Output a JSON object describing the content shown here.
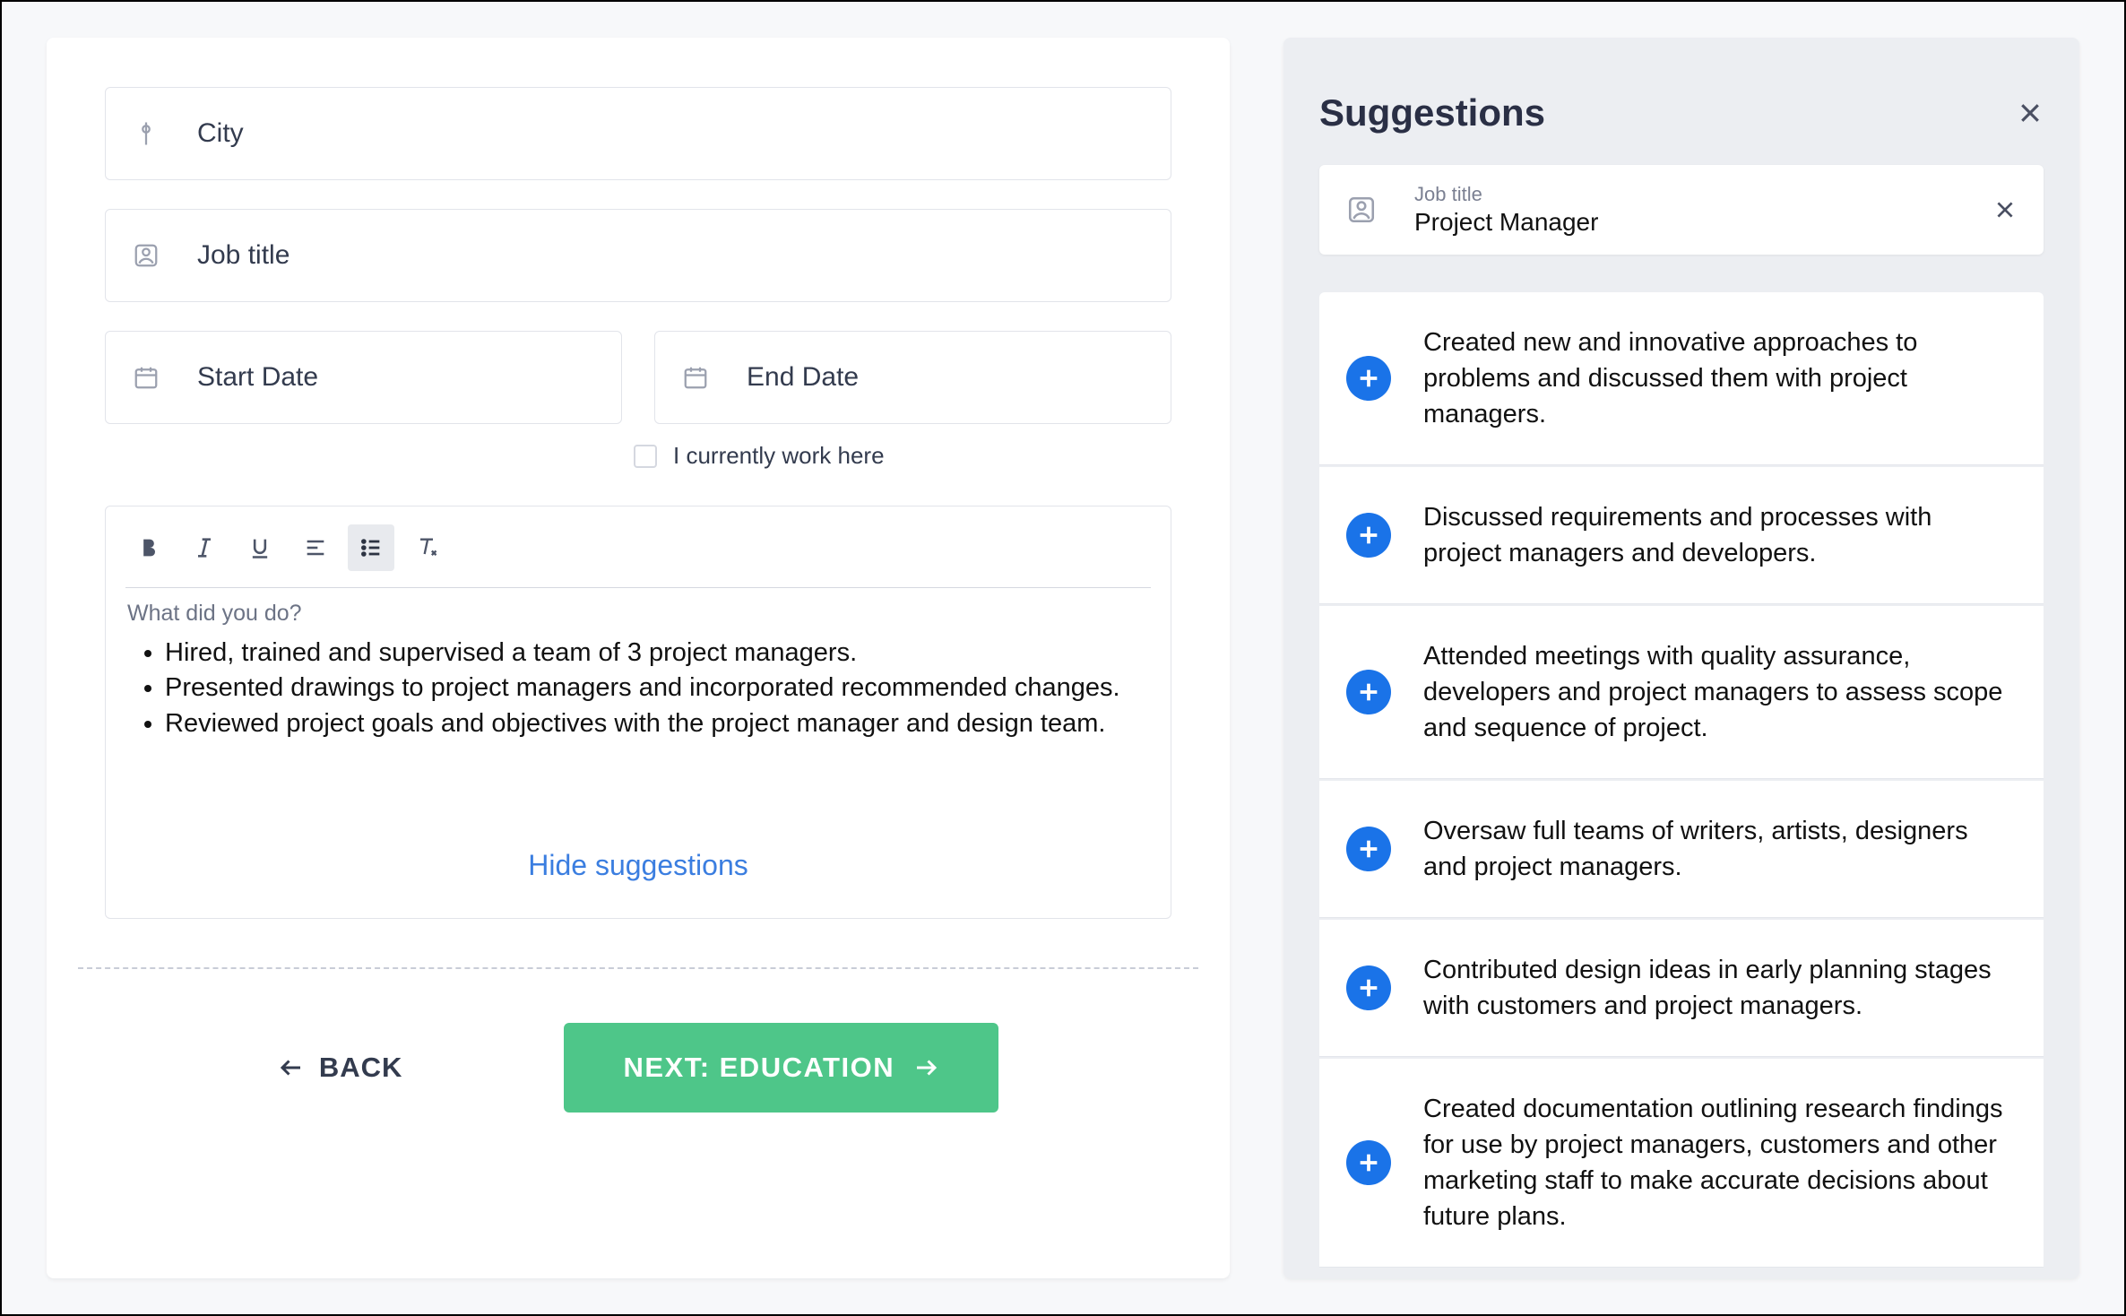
{
  "form": {
    "city_placeholder": "City",
    "job_title_placeholder": "Job title",
    "start_date_placeholder": "Start Date",
    "end_date_placeholder": "End Date",
    "currently_work_label": "I currently work here",
    "description_question": "What did you do?",
    "bullets": [
      "Hired, trained and supervised a team of 3 project managers.",
      "Presented drawings to project managers and incorporated recommended changes.",
      "Reviewed project goals and objectives with the project manager and design team."
    ],
    "hide_suggestions": "Hide suggestions",
    "back_label": "BACK",
    "next_label": "NEXT: EDUCATION"
  },
  "suggestions": {
    "title": "Suggestions",
    "job_title_label": "Job title",
    "job_title_value": "Project Manager",
    "items": [
      "Created new and innovative approaches to problems and discussed them with project managers.",
      "Discussed requirements and processes with project managers and developers.",
      "Attended meetings with quality assurance, developers and project managers to assess scope and sequence of project.",
      "Oversaw full teams of writers, artists, designers and project managers.",
      "Contributed design ideas in early planning stages with customers and project managers.",
      "Created documentation outlining research findings for use by project managers, customers and other marketing staff to make accurate decisions about future plans."
    ]
  }
}
